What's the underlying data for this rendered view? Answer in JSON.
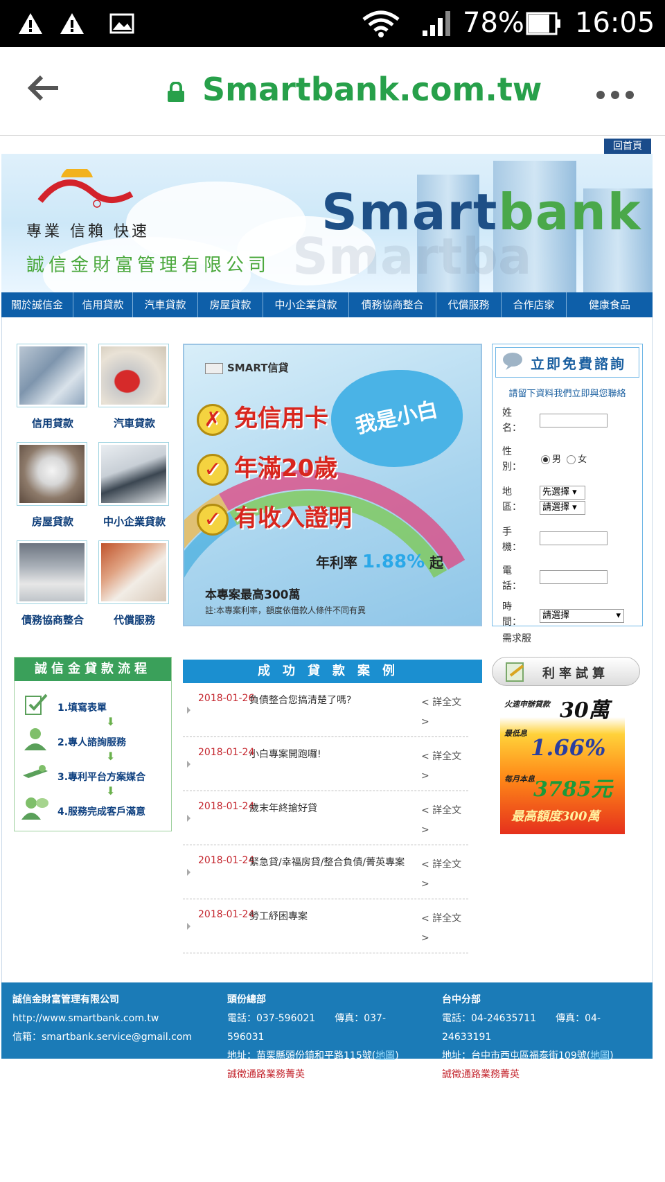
{
  "status_bar": {
    "icons": [
      "warning-icon",
      "warning-icon",
      "image-icon",
      "wifi-icon",
      "signal-icon",
      "battery-icon"
    ],
    "battery": "78%",
    "time": "16:05"
  },
  "browser": {
    "url": "Smartbank.com.tw",
    "icons": [
      "back-arrow-icon",
      "lock-icon",
      "more-icon"
    ]
  },
  "top": {
    "home_link": "回首頁"
  },
  "banner": {
    "slogan": "專業 信賴 快速",
    "company": "誠信金財富管理有限公司",
    "brand_part1": "Smart",
    "brand_part2": "bank"
  },
  "nav": [
    {
      "label": "關於誠信金"
    },
    {
      "label": "信用貸款"
    },
    {
      "label": "汽車貸款"
    },
    {
      "label": "房屋貸款"
    },
    {
      "label": "中小企業貸款"
    },
    {
      "label": "債務協商整合"
    },
    {
      "label": "代償服務"
    },
    {
      "label": "合作店家"
    },
    {
      "label": "健康食品"
    }
  ],
  "tiles": [
    {
      "label": "信用貸款"
    },
    {
      "label": "汽車貸款"
    },
    {
      "label": "房屋貸款"
    },
    {
      "label": "中小企業貸款"
    },
    {
      "label": "債務協商整合"
    },
    {
      "label": "代償服務"
    }
  ],
  "promo": {
    "header": "SMART信貸",
    "bubble": "我是小白",
    "items": [
      {
        "text": "免信用卡",
        "mark": "✗"
      },
      {
        "text": "年滿20歲",
        "mark": "✓"
      },
      {
        "text": "有收入證明",
        "mark": "✓"
      }
    ],
    "rate_prefix": "年利率",
    "rate_value": "1.88%",
    "rate_suffix": "起",
    "max": "本專案最高300萬",
    "note": "註:本專案利率，額度依借款人條件不同有異"
  },
  "consult": {
    "title": "立即免費諮詢",
    "subtitle": "請留下資料我們立即與您聯絡",
    "name_label": "姓名：",
    "gender_label": "性別：",
    "gender_male": "男",
    "gender_female": "女",
    "area_label": "地區：",
    "area_select1": "先選擇",
    "area_select2": "請選擇",
    "mobile_label": "手機：",
    "phone_label": "電話：",
    "time_label": "時間：",
    "time_select": "請選擇",
    "need_label": "需求服"
  },
  "flow": {
    "title": "誠信金貸款流程",
    "steps": [
      {
        "label": "1.填寫表單"
      },
      {
        "label": "2.專人諮詢服務"
      },
      {
        "label": "3.專利平台方案媒合"
      },
      {
        "label": "4.服務完成客戶滿意"
      }
    ]
  },
  "cases": {
    "title": "成功貸款案例",
    "more": "< 詳全文 >",
    "items": [
      {
        "date": "2018-01-26",
        "title": "負債整合您搞清楚了嗎?"
      },
      {
        "date": "2018-01-24",
        "title": "小白專案開跑囉!"
      },
      {
        "date": "2018-01-24",
        "title": "歲末年終搶好貸"
      },
      {
        "date": "2018-01-24",
        "title": "緊急貸/幸福房貸/整合負債/菁英專案"
      },
      {
        "date": "2018-01-24",
        "title": "勞工紓困專案"
      }
    ]
  },
  "calc": {
    "label": "利率試算",
    "ad_line1": "火速申辦貸款",
    "ad_amount": "30萬",
    "ad_low": "最低息",
    "ad_rate": "1.66%",
    "ad_monthly": "每月本息",
    "ad_payment": "3785元",
    "ad_max": "最高額度300萬"
  },
  "footer": {
    "company": "誠信金財富管理有限公司",
    "url": "http://www.smartbank.com.tw",
    "email": "信箱：smartbank.service@gmail.com",
    "hq_title": "頭份總部",
    "hq_phone": "電話：037-596021　　傳真：037-596031",
    "hq_addr": "地址：苗栗縣頭份鎮和平路115號(",
    "hq_map": "地圖",
    "hq_recruit": "誠徵通路業務菁英",
    "tc_title": "台中分部",
    "tc_phone": "電話：04-24635711　　傳真：04-24633191",
    "tc_addr": "地址：台中市西屯區福泰街109號(",
    "tc_map": "地圖",
    "tc_recruit": "誠徵通路業務菁英",
    "close_paren": ")"
  }
}
